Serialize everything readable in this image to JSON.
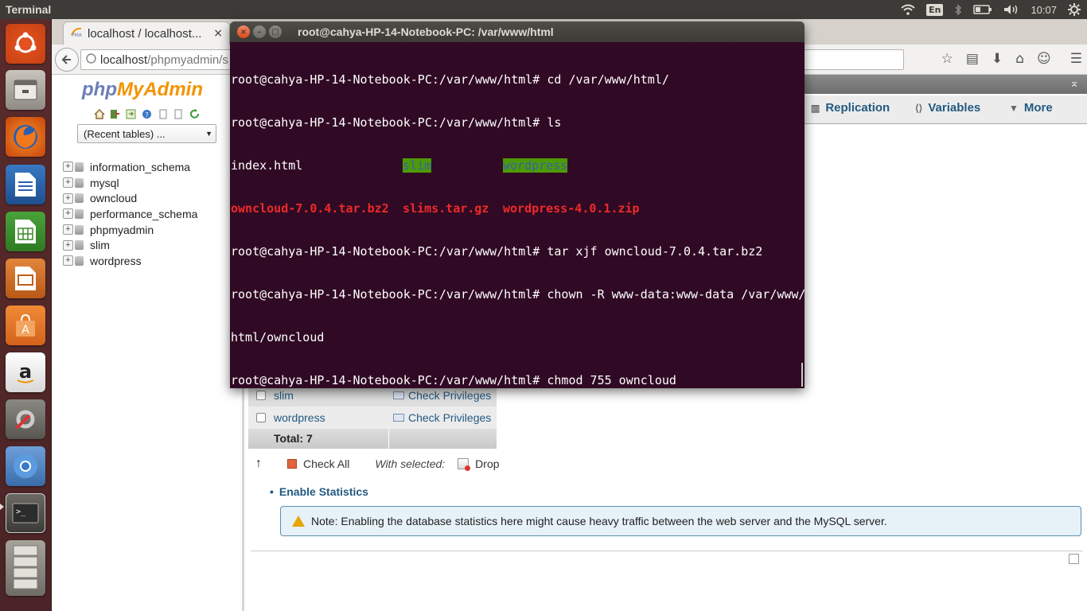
{
  "panel": {
    "app_title": "Terminal",
    "keyboard": "En",
    "clock": "10:07"
  },
  "launcher": {
    "items": [
      "ubuntu-dash",
      "files",
      "firefox",
      "libreoffice-writer",
      "libreoffice-calc",
      "libreoffice-impress",
      "software-center",
      "amazon",
      "system-settings",
      "chromium",
      "terminal",
      "workspaces"
    ]
  },
  "browser": {
    "tab_title": "localhost / localhost...",
    "tab_close": "×",
    "url_host": "localhost",
    "url_path": "/phpmyadmin/s"
  },
  "pma": {
    "logo_php": "php",
    "logo_myadmin": "MyAdmin",
    "recent_tables": "(Recent tables) ...",
    "databases": [
      "information_schema",
      "mysql",
      "owncloud",
      "performance_schema",
      "phpmyadmin",
      "slim",
      "wordpress"
    ],
    "tabs": [
      {
        "label": "Replication",
        "icon": "replication-icon"
      },
      {
        "label": "Variables",
        "icon": "variables-icon"
      },
      {
        "label": "More",
        "icon": "chevron-down-icon"
      }
    ],
    "table_rows": [
      {
        "name": "slim",
        "action": "Check Privileges"
      },
      {
        "name": "wordpress",
        "action": "Check Privileges"
      }
    ],
    "total": "Total: 7",
    "check_all": "Check All",
    "with_selected": "With selected:",
    "drop": "Drop",
    "enable_statistics": "Enable Statistics",
    "notice": "Note: Enabling the database statistics here might cause heavy traffic between the web server and the MySQL server."
  },
  "terminal": {
    "title": "root@cahya-HP-14-Notebook-PC: /var/www/html",
    "prompt": "root@cahya-HP-14-Notebook-PC:/var/www/html# ",
    "lines": {
      "l1_cmd": "cd /var/www/html/",
      "l2_cmd": "ls",
      "ls_a1": "index.html",
      "ls_a2": "slim",
      "ls_a3": "wordpress",
      "ls_b1": "owncloud-7.0.4.tar.bz2",
      "ls_b2": "slims.tar.gz",
      "ls_b3": "wordpress-4.0.1.zip",
      "l5_cmd": "tar xjf owncloud-7.0.4.tar.bz2",
      "l6_cmd": "chown -R www-data:www-data /var/www/",
      "l6_wrap": "html/owncloud",
      "l7_cmd": "chmod 755 owncloud"
    }
  },
  "colors": {
    "terminal_bg": "#300a24",
    "launcher_bg": "#5a2b2b",
    "pma_link": "#235a81",
    "panel_bg": "#3c3b37"
  }
}
